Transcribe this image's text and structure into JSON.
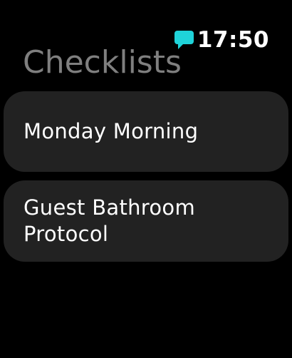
{
  "status": {
    "time": "17:50",
    "notification_icon": "message-bubble-icon",
    "notification_color": "#1fd3d9"
  },
  "header": {
    "title": "Checklists"
  },
  "checklists": [
    {
      "label": "Monday Morning"
    },
    {
      "label": "Guest Bathroom Protocol"
    }
  ],
  "colors": {
    "background": "#000000",
    "card": "#222222",
    "title": "#7f7f7f",
    "text": "#ffffff"
  }
}
